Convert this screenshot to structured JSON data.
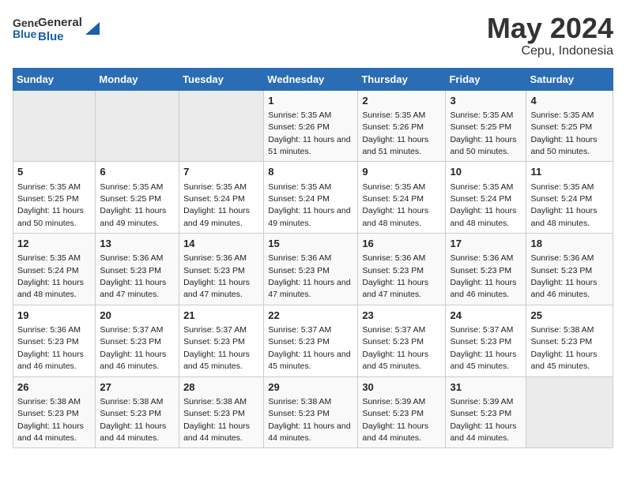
{
  "logo": {
    "text_general": "General",
    "text_blue": "Blue"
  },
  "header": {
    "month": "May 2024",
    "location": "Cepu, Indonesia"
  },
  "weekdays": [
    "Sunday",
    "Monday",
    "Tuesday",
    "Wednesday",
    "Thursday",
    "Friday",
    "Saturday"
  ],
  "weeks": [
    [
      {
        "day": "",
        "sunrise": "",
        "sunset": "",
        "daylight": "",
        "empty": true
      },
      {
        "day": "",
        "sunrise": "",
        "sunset": "",
        "daylight": "",
        "empty": true
      },
      {
        "day": "",
        "sunrise": "",
        "sunset": "",
        "daylight": "",
        "empty": true
      },
      {
        "day": "1",
        "sunrise": "Sunrise: 5:35 AM",
        "sunset": "Sunset: 5:26 PM",
        "daylight": "Daylight: 11 hours and 51 minutes."
      },
      {
        "day": "2",
        "sunrise": "Sunrise: 5:35 AM",
        "sunset": "Sunset: 5:26 PM",
        "daylight": "Daylight: 11 hours and 51 minutes."
      },
      {
        "day": "3",
        "sunrise": "Sunrise: 5:35 AM",
        "sunset": "Sunset: 5:25 PM",
        "daylight": "Daylight: 11 hours and 50 minutes."
      },
      {
        "day": "4",
        "sunrise": "Sunrise: 5:35 AM",
        "sunset": "Sunset: 5:25 PM",
        "daylight": "Daylight: 11 hours and 50 minutes."
      }
    ],
    [
      {
        "day": "5",
        "sunrise": "Sunrise: 5:35 AM",
        "sunset": "Sunset: 5:25 PM",
        "daylight": "Daylight: 11 hours and 50 minutes."
      },
      {
        "day": "6",
        "sunrise": "Sunrise: 5:35 AM",
        "sunset": "Sunset: 5:25 PM",
        "daylight": "Daylight: 11 hours and 49 minutes."
      },
      {
        "day": "7",
        "sunrise": "Sunrise: 5:35 AM",
        "sunset": "Sunset: 5:24 PM",
        "daylight": "Daylight: 11 hours and 49 minutes."
      },
      {
        "day": "8",
        "sunrise": "Sunrise: 5:35 AM",
        "sunset": "Sunset: 5:24 PM",
        "daylight": "Daylight: 11 hours and 49 minutes."
      },
      {
        "day": "9",
        "sunrise": "Sunrise: 5:35 AM",
        "sunset": "Sunset: 5:24 PM",
        "daylight": "Daylight: 11 hours and 48 minutes."
      },
      {
        "day": "10",
        "sunrise": "Sunrise: 5:35 AM",
        "sunset": "Sunset: 5:24 PM",
        "daylight": "Daylight: 11 hours and 48 minutes."
      },
      {
        "day": "11",
        "sunrise": "Sunrise: 5:35 AM",
        "sunset": "Sunset: 5:24 PM",
        "daylight": "Daylight: 11 hours and 48 minutes."
      }
    ],
    [
      {
        "day": "12",
        "sunrise": "Sunrise: 5:35 AM",
        "sunset": "Sunset: 5:24 PM",
        "daylight": "Daylight: 11 hours and 48 minutes."
      },
      {
        "day": "13",
        "sunrise": "Sunrise: 5:36 AM",
        "sunset": "Sunset: 5:23 PM",
        "daylight": "Daylight: 11 hours and 47 minutes."
      },
      {
        "day": "14",
        "sunrise": "Sunrise: 5:36 AM",
        "sunset": "Sunset: 5:23 PM",
        "daylight": "Daylight: 11 hours and 47 minutes."
      },
      {
        "day": "15",
        "sunrise": "Sunrise: 5:36 AM",
        "sunset": "Sunset: 5:23 PM",
        "daylight": "Daylight: 11 hours and 47 minutes."
      },
      {
        "day": "16",
        "sunrise": "Sunrise: 5:36 AM",
        "sunset": "Sunset: 5:23 PM",
        "daylight": "Daylight: 11 hours and 47 minutes."
      },
      {
        "day": "17",
        "sunrise": "Sunrise: 5:36 AM",
        "sunset": "Sunset: 5:23 PM",
        "daylight": "Daylight: 11 hours and 46 minutes."
      },
      {
        "day": "18",
        "sunrise": "Sunrise: 5:36 AM",
        "sunset": "Sunset: 5:23 PM",
        "daylight": "Daylight: 11 hours and 46 minutes."
      }
    ],
    [
      {
        "day": "19",
        "sunrise": "Sunrise: 5:36 AM",
        "sunset": "Sunset: 5:23 PM",
        "daylight": "Daylight: 11 hours and 46 minutes."
      },
      {
        "day": "20",
        "sunrise": "Sunrise: 5:37 AM",
        "sunset": "Sunset: 5:23 PM",
        "daylight": "Daylight: 11 hours and 46 minutes."
      },
      {
        "day": "21",
        "sunrise": "Sunrise: 5:37 AM",
        "sunset": "Sunset: 5:23 PM",
        "daylight": "Daylight: 11 hours and 45 minutes."
      },
      {
        "day": "22",
        "sunrise": "Sunrise: 5:37 AM",
        "sunset": "Sunset: 5:23 PM",
        "daylight": "Daylight: 11 hours and 45 minutes."
      },
      {
        "day": "23",
        "sunrise": "Sunrise: 5:37 AM",
        "sunset": "Sunset: 5:23 PM",
        "daylight": "Daylight: 11 hours and 45 minutes."
      },
      {
        "day": "24",
        "sunrise": "Sunrise: 5:37 AM",
        "sunset": "Sunset: 5:23 PM",
        "daylight": "Daylight: 11 hours and 45 minutes."
      },
      {
        "day": "25",
        "sunrise": "Sunrise: 5:38 AM",
        "sunset": "Sunset: 5:23 PM",
        "daylight": "Daylight: 11 hours and 45 minutes."
      }
    ],
    [
      {
        "day": "26",
        "sunrise": "Sunrise: 5:38 AM",
        "sunset": "Sunset: 5:23 PM",
        "daylight": "Daylight: 11 hours and 44 minutes."
      },
      {
        "day": "27",
        "sunrise": "Sunrise: 5:38 AM",
        "sunset": "Sunset: 5:23 PM",
        "daylight": "Daylight: 11 hours and 44 minutes."
      },
      {
        "day": "28",
        "sunrise": "Sunrise: 5:38 AM",
        "sunset": "Sunset: 5:23 PM",
        "daylight": "Daylight: 11 hours and 44 minutes."
      },
      {
        "day": "29",
        "sunrise": "Sunrise: 5:38 AM",
        "sunset": "Sunset: 5:23 PM",
        "daylight": "Daylight: 11 hours and 44 minutes."
      },
      {
        "day": "30",
        "sunrise": "Sunrise: 5:39 AM",
        "sunset": "Sunset: 5:23 PM",
        "daylight": "Daylight: 11 hours and 44 minutes."
      },
      {
        "day": "31",
        "sunrise": "Sunrise: 5:39 AM",
        "sunset": "Sunset: 5:23 PM",
        "daylight": "Daylight: 11 hours and 44 minutes."
      },
      {
        "day": "",
        "sunrise": "",
        "sunset": "",
        "daylight": "",
        "empty": true
      }
    ]
  ]
}
